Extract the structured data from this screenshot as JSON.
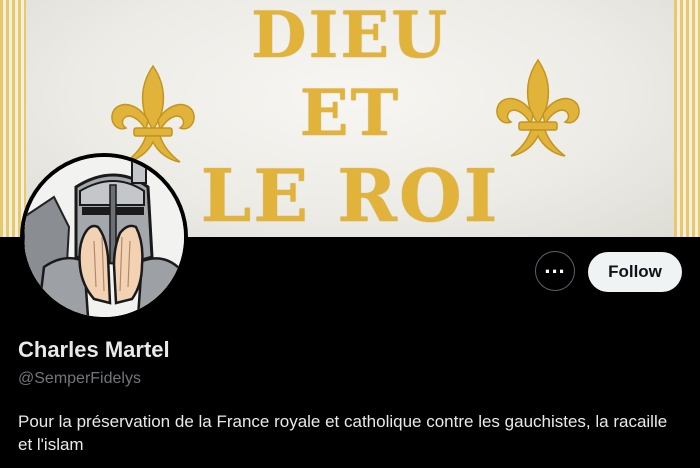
{
  "banner": {
    "motto_line_1": "DIEU",
    "motto_line_2": "ET",
    "motto_line_3": "LE ROI"
  },
  "profile": {
    "display_name": "Charles Martel",
    "handle": "@SemperFidelys",
    "bio": "Pour la préservation de la France royale et catholique contre les gauchistes, la racaille et l'islam"
  },
  "actions": {
    "more_label": "...",
    "follow_label": "Follow"
  },
  "colors": {
    "background": "#000000",
    "gold": "#e2b33a",
    "follow_bg": "#eff3f4",
    "text_primary": "#e7e9ea",
    "text_secondary": "#71767b"
  },
  "icons": {
    "banner_ornament": "fleur-de-lis-icon",
    "more": "more-options-icon"
  }
}
